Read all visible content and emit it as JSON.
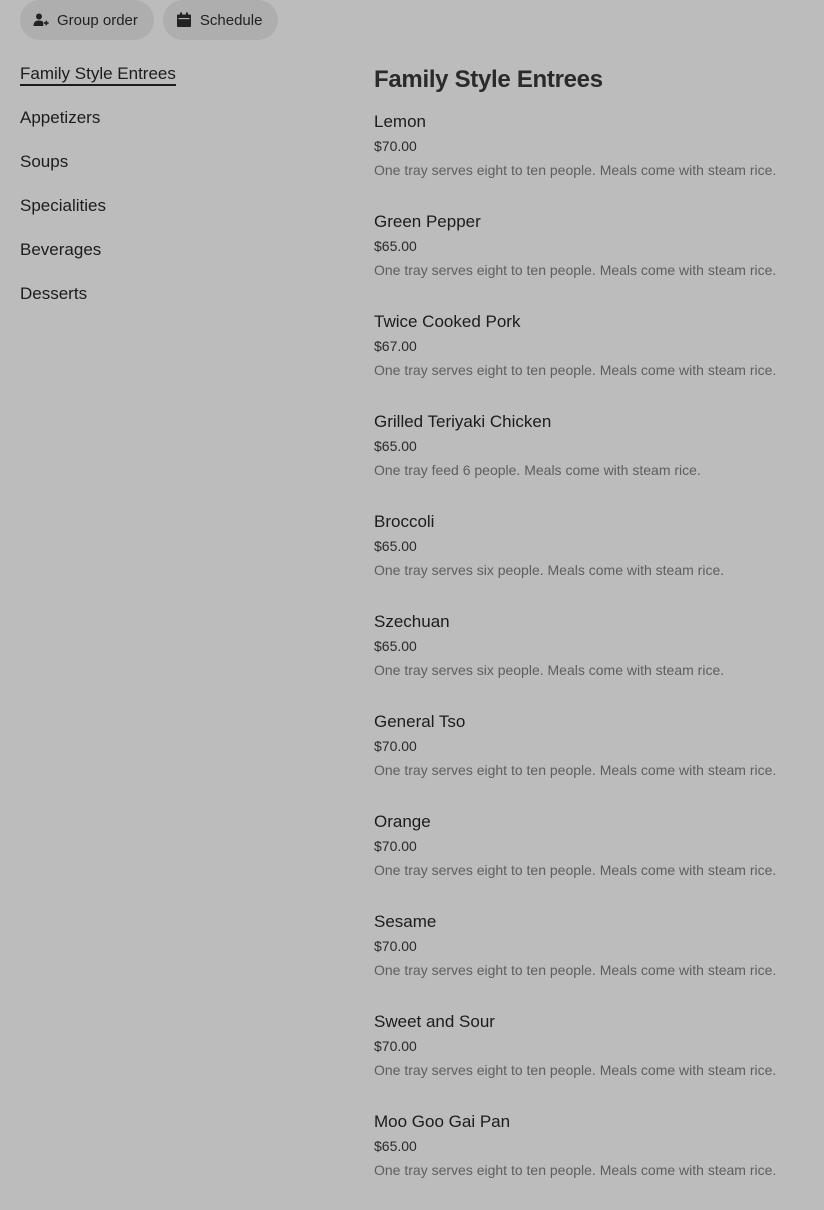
{
  "toolbar": {
    "group_order_label": "Group order",
    "schedule_label": "Schedule"
  },
  "sidebar": {
    "categories": [
      {
        "label": "Family Style Entrees",
        "active": true
      },
      {
        "label": "Appetizers",
        "active": false
      },
      {
        "label": "Soups",
        "active": false
      },
      {
        "label": "Specialities",
        "active": false
      },
      {
        "label": "Beverages",
        "active": false
      },
      {
        "label": "Desserts",
        "active": false
      }
    ]
  },
  "main": {
    "section_title": "Family Style Entrees",
    "items": [
      {
        "name": "Lemon",
        "price": "$70.00",
        "desc": "One tray serves eight to ten people. Meals come with steam rice."
      },
      {
        "name": "Green Pepper",
        "price": "$65.00",
        "desc": "One tray serves eight to ten people. Meals come with steam rice."
      },
      {
        "name": "Twice Cooked Pork",
        "price": "$67.00",
        "desc": "One tray serves eight to ten people. Meals come with steam rice."
      },
      {
        "name": "Grilled Teriyaki Chicken",
        "price": "$65.00",
        "desc": "One tray feed 6 people. Meals come with steam rice."
      },
      {
        "name": "Broccoli",
        "price": "$65.00",
        "desc": "One tray serves six people. Meals come with steam rice."
      },
      {
        "name": "Szechuan",
        "price": "$65.00",
        "desc": "One tray serves six people. Meals come with steam rice."
      },
      {
        "name": "General Tso",
        "price": "$70.00",
        "desc": "One tray serves eight to ten people. Meals come with steam rice."
      },
      {
        "name": "Orange",
        "price": "$70.00",
        "desc": "One tray serves eight to ten people. Meals come with steam rice."
      },
      {
        "name": "Sesame",
        "price": "$70.00",
        "desc": "One tray serves eight to ten people. Meals come with steam rice."
      },
      {
        "name": "Sweet and Sour",
        "price": "$70.00",
        "desc": "One tray serves eight to ten people. Meals come with steam rice."
      },
      {
        "name": "Moo Goo Gai Pan",
        "price": "$65.00",
        "desc": "One tray serves eight to ten people. Meals come with steam rice."
      }
    ]
  },
  "icons": {
    "group_order": "person-add-icon",
    "schedule": "calendar-icon"
  }
}
